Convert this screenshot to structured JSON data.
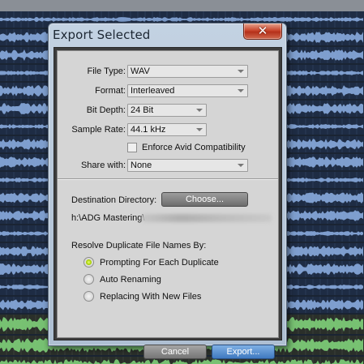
{
  "dialog": {
    "title": "Export Selected",
    "close_glyph": "✕"
  },
  "form": {
    "file_type": {
      "label": "File Type:",
      "value": "WAV"
    },
    "format": {
      "label": "Format:",
      "value": "Interleaved"
    },
    "bit_depth": {
      "label": "Bit Depth:",
      "value": "24 Bit"
    },
    "sample_rate": {
      "label": "Sample Rate:",
      "value": "44.1 kHz"
    },
    "enforce_avid": {
      "label": "Enforce Avid Compatibility",
      "checked": false
    },
    "share_with": {
      "label": "Share with:",
      "value": "None"
    }
  },
  "destination": {
    "label": "Destination Directory:",
    "choose_label": "Choose...",
    "path": "h:\\ADG Mastering\\"
  },
  "duplicates": {
    "label": "Resolve Duplicate File Names By:",
    "options": [
      {
        "label": "Prompting For Each Duplicate",
        "selected": true
      },
      {
        "label": "Auto Renaming",
        "selected": false
      },
      {
        "label": "Replacing With New Files",
        "selected": false
      }
    ]
  },
  "buttons": {
    "cancel": "Cancel",
    "export": "Export..."
  },
  "colors": {
    "titlebar": "#b8c9dc",
    "close_button": "#c9462d",
    "export_button": "#3f79c0",
    "radio_selected": "#a9d000",
    "waveform_blue": "#8fb3e6",
    "waveform_green": "#7fd27a",
    "track_bg": "#1e2c44"
  }
}
